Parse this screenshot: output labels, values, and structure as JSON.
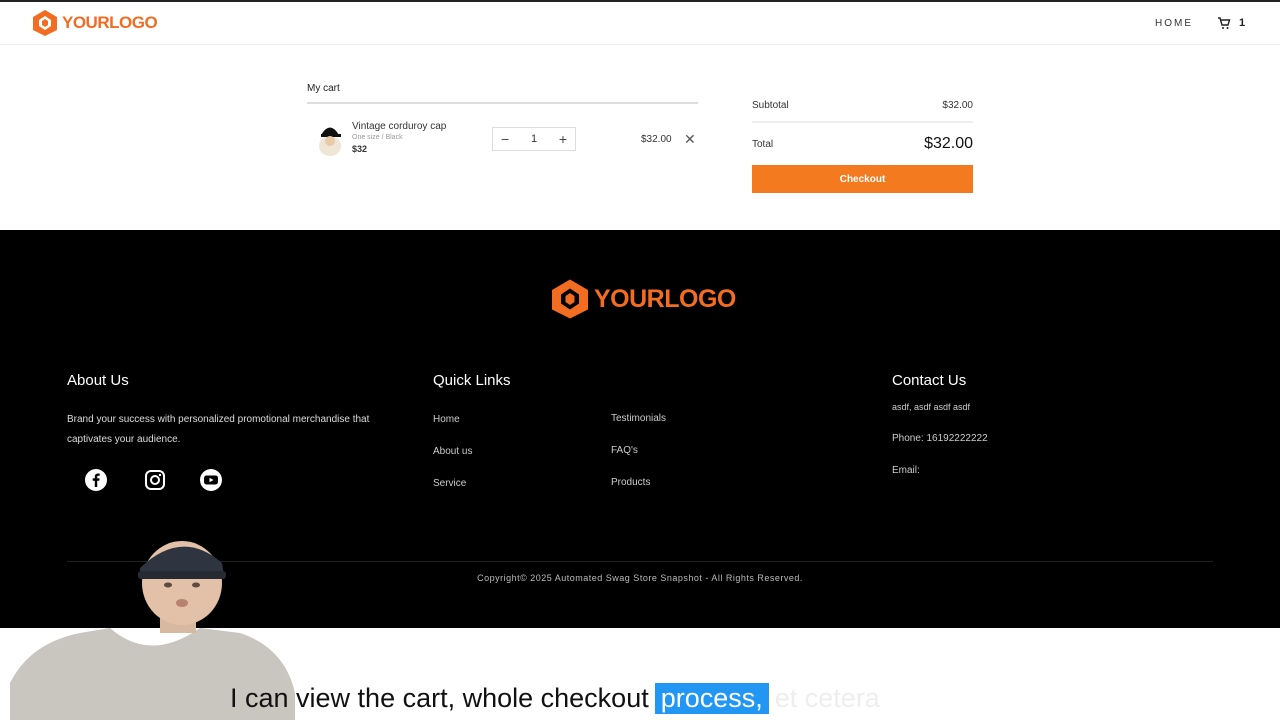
{
  "header": {
    "logo_text": "YOURLOGO",
    "nav_home": "HOME",
    "cart_count": "1"
  },
  "cart": {
    "title": "My cart",
    "item": {
      "name": "Vintage corduroy cap",
      "variant": "One size / Black",
      "price": "$32",
      "quantity": "1",
      "line_total": "$32.00"
    }
  },
  "summary": {
    "subtotal_label": "Subtotal",
    "subtotal_value": "$32.00",
    "total_label": "Total",
    "total_value": "$32.00",
    "checkout_label": "Checkout"
  },
  "footer": {
    "logo_text": "YOURLOGO",
    "about": {
      "title": "About Us",
      "text": "Brand your success with personalized promotional merchandise that captivates your audience."
    },
    "quick_links": {
      "title": "Quick Links",
      "col1": [
        "Home",
        "About us",
        "Service"
      ],
      "col2": [
        "Testimonials",
        "FAQ's",
        "Products"
      ]
    },
    "contact": {
      "title": "Contact Us",
      "address": "asdf, asdf asdf asdf",
      "phone": "Phone: 16192222222",
      "email": "Email:"
    },
    "copyright": "Copyright© 2025 Automated Swag Store Snapshot - All Rights Reserved."
  },
  "caption": {
    "text": "I can view the cart, whole checkout",
    "highlight": "process,",
    "faded": "et cetera"
  },
  "colors": {
    "accent": "#f47a20",
    "footer_bg": "#000000",
    "caption_highlight": "#2196f3"
  },
  "icons": [
    "hexagon-logo-icon",
    "cart-icon",
    "minus-icon",
    "plus-icon",
    "close-icon",
    "facebook-icon",
    "instagram-icon",
    "youtube-icon"
  ]
}
